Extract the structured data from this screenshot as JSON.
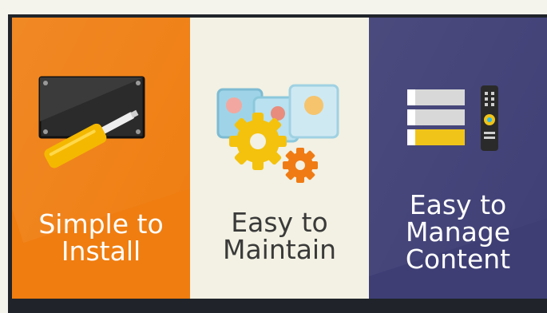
{
  "panels": [
    {
      "title": "Simple to\nInstall",
      "icon": "screwdriver-monitor-icon",
      "color": "#ef7d10"
    },
    {
      "title": "Easy to\nMaintain",
      "icon": "gears-icon",
      "color": "#f2f1e3"
    },
    {
      "title": "Easy to\nManage\nContent",
      "icon": "remote-playlist-icon",
      "color": "#3e3e75"
    }
  ]
}
